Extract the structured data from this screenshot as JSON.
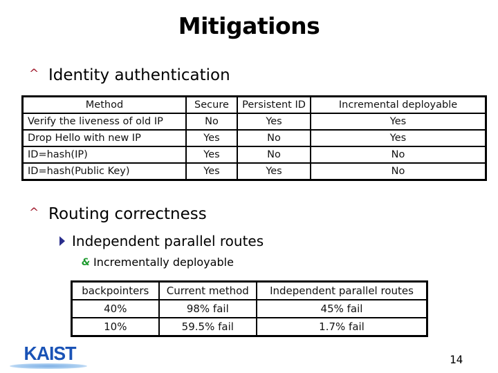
{
  "slide": {
    "title": "Mitigations",
    "page_number": "14",
    "logo_text": "KAIST"
  },
  "colors": {
    "level1_bullet": "#a0192c",
    "level2_bullet": "#2a2e8c",
    "level3_bullet": "#1e9a2e",
    "logo": "#1a53b6"
  },
  "sections": [
    {
      "bullet_icon": "caret-up-icon",
      "heading": "Identity authentication"
    },
    {
      "bullet_icon": "caret-up-icon",
      "heading": "Routing correctness",
      "sub": {
        "bullet_icon": "triangle-right-icon",
        "text": "Independent parallel routes",
        "sub": {
          "bullet_icon": "ribbon-icon",
          "text": "Incrementally deployable"
        }
      }
    }
  ],
  "identity_table": {
    "headers": [
      "Method",
      "Secure",
      "Persistent ID",
      "Incremental deployable"
    ],
    "rows": [
      [
        "Verify the liveness of old IP",
        "No",
        "Yes",
        "Yes"
      ],
      [
        "Drop Hello with new IP",
        "Yes",
        "No",
        "Yes"
      ],
      [
        "ID=hash(IP)",
        "Yes",
        "No",
        "No"
      ],
      [
        "ID=hash(Public Key)",
        "Yes",
        "Yes",
        "No"
      ]
    ]
  },
  "routing_table": {
    "headers": [
      "backpointers",
      "Current method",
      "Independent parallel routes"
    ],
    "rows": [
      [
        "40%",
        "98% fail",
        "45% fail"
      ],
      [
        "10%",
        "59.5% fail",
        "1.7% fail"
      ]
    ]
  }
}
